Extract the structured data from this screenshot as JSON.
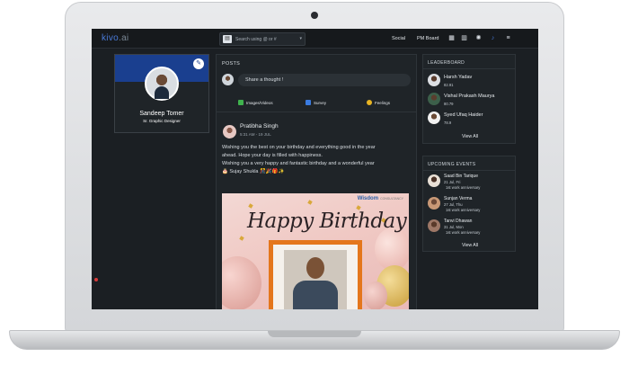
{
  "topbar": {
    "logo_main": "kivo",
    "logo_ai": ".ai",
    "search_placeholder": "Search using @ or #",
    "nav": [
      "Social",
      "PM Board"
    ],
    "icons": [
      "grid-icon",
      "chart-icon",
      "gear-icon",
      "bell-icon",
      "menu-icon"
    ]
  },
  "profile": {
    "name": "Sandeep Tomer",
    "role": "Sr. Graphic Designer"
  },
  "posts": {
    "heading": "POSTS",
    "compose_placeholder": "Share a thought !",
    "actions": [
      {
        "label": "Images/Videos",
        "color": "#3fb24d",
        "icon": "image-icon"
      },
      {
        "label": "Survey",
        "color": "#3a7be0",
        "icon": "survey-icon"
      },
      {
        "label": "Feelings",
        "color": "#e8b423",
        "icon": "smiley-icon"
      }
    ],
    "post": {
      "author": "Pratibha Singh",
      "time": "5:31 AM - 19 JUL",
      "body_lines": [
        "Wishing you the best on your birthday and everything good in the year",
        "ahead. Hope your day is filled with happiness.",
        "Wishing you a very happy and fantastic birthday and a wonderful year",
        "🎂 Sujay Shukla 🎊🎉🎁✨"
      ],
      "image": {
        "brand": "Wisdom",
        "brand_small": "CONSULTANCY",
        "headline": "Happy Birthday"
      }
    }
  },
  "leaderboard": {
    "heading": "LEADERBOARD",
    "rows": [
      {
        "name": "Harsh Yadav",
        "score": "82.91"
      },
      {
        "name": "Vishal Prakash Maurya",
        "score": "80.79"
      },
      {
        "name": "Syed Ufaq Haider",
        "score": "78.9"
      }
    ],
    "view_all": "View All"
  },
  "events": {
    "heading": "UPCOMING EVENTS",
    "rows": [
      {
        "name": "Saad Bin Tarique",
        "date": "21 Jul, Fri",
        "note": "1st work anniversary"
      },
      {
        "name": "Sunjan Verma",
        "date": "27 Jul, Thu",
        "note": "1st work anniversary"
      },
      {
        "name": "Tanvi Dhawan",
        "date": "31 Jul, Mon",
        "note": "1st work anniversary"
      }
    ],
    "view_all": "View All"
  }
}
